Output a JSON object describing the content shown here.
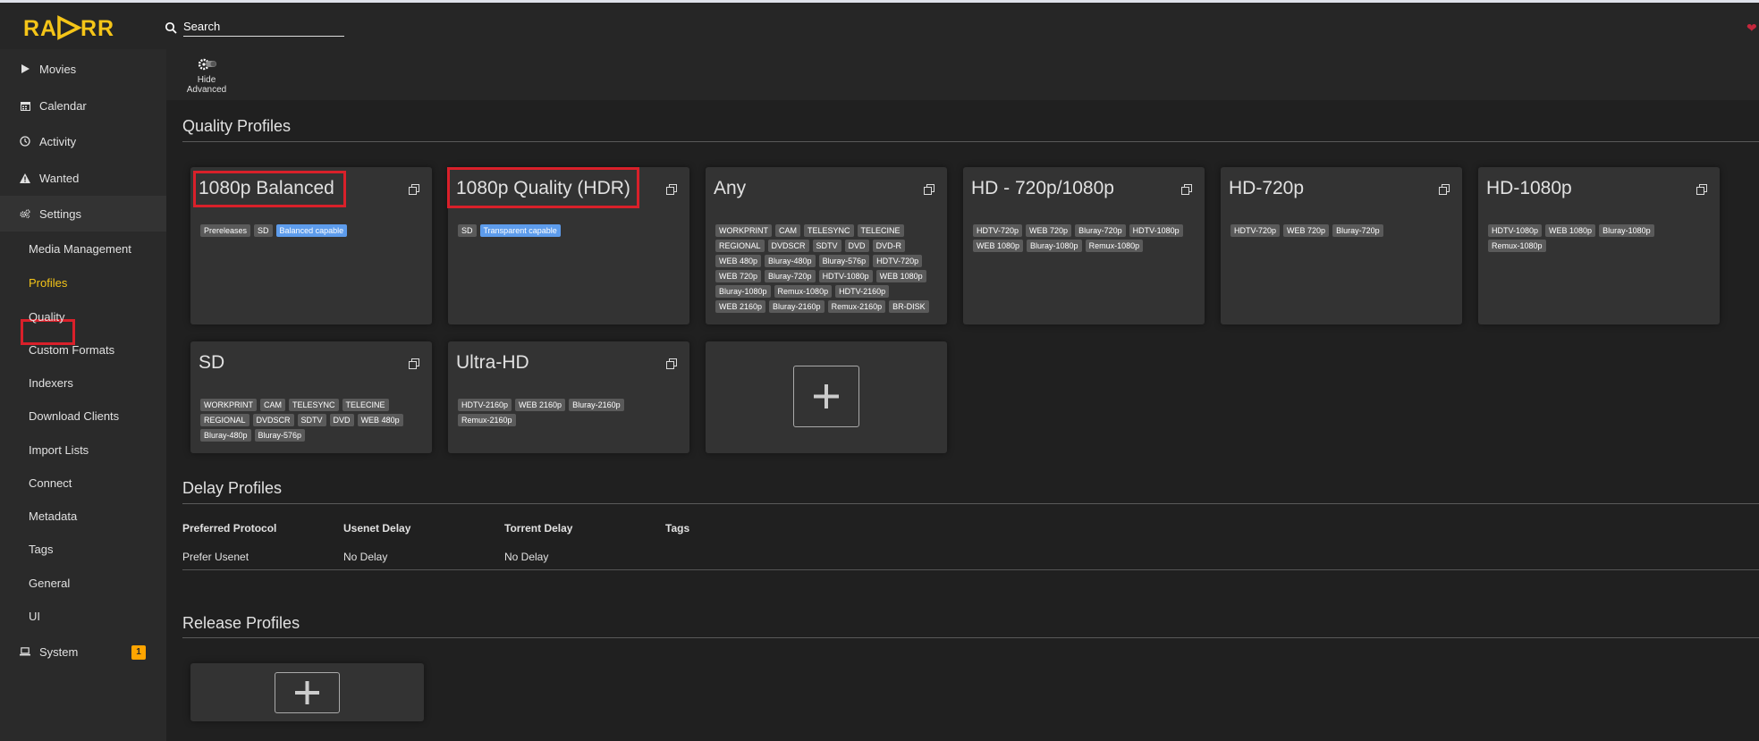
{
  "header": {
    "logo_text": "RADARR",
    "search_placeholder": "Search"
  },
  "sidebar": {
    "items": [
      {
        "label": "Movies",
        "icon": "play-icon"
      },
      {
        "label": "Calendar",
        "icon": "calendar-icon"
      },
      {
        "label": "Activity",
        "icon": "clock-icon"
      },
      {
        "label": "Wanted",
        "icon": "warning-icon"
      },
      {
        "label": "Settings",
        "icon": "gears-icon"
      },
      {
        "label": "System",
        "icon": "laptop-icon",
        "badge": "1"
      }
    ],
    "settings_children": [
      "Media Management",
      "Profiles",
      "Quality",
      "Custom Formats",
      "Indexers",
      "Download Clients",
      "Import Lists",
      "Connect",
      "Metadata",
      "Tags",
      "General",
      "UI"
    ],
    "selected_child": "Profiles"
  },
  "toolbar": {
    "advanced_label_line1": "Hide",
    "advanced_label_line2": "Advanced"
  },
  "quality_profiles": {
    "title": "Quality Profiles",
    "profiles": [
      {
        "name": "1080p Balanced",
        "tags": [
          "Prereleases",
          "SD"
        ],
        "info_tags": [
          "Balanced capable"
        ]
      },
      {
        "name": "1080p Quality (HDR)",
        "tags": [
          "SD"
        ],
        "info_tags": [
          "Transparent capable"
        ]
      },
      {
        "name": "Any",
        "tags": [
          "WORKPRINT",
          "CAM",
          "TELESYNC",
          "TELECINE",
          "REGIONAL",
          "DVDSCR",
          "SDTV",
          "DVD",
          "DVD-R",
          "WEB 480p",
          "Bluray-480p",
          "Bluray-576p",
          "HDTV-720p",
          "WEB 720p",
          "Bluray-720p",
          "HDTV-1080p",
          "WEB 1080p",
          "Bluray-1080p",
          "Remux-1080p",
          "HDTV-2160p",
          "WEB 2160p",
          "Bluray-2160p",
          "Remux-2160p",
          "BR-DISK"
        ],
        "info_tags": []
      },
      {
        "name": "HD - 720p/1080p",
        "tags": [
          "HDTV-720p",
          "WEB 720p",
          "Bluray-720p",
          "HDTV-1080p",
          "WEB 1080p",
          "Bluray-1080p",
          "Remux-1080p"
        ],
        "info_tags": []
      },
      {
        "name": "HD-720p",
        "tags": [
          "HDTV-720p",
          "WEB 720p",
          "Bluray-720p"
        ],
        "info_tags": []
      },
      {
        "name": "HD-1080p",
        "tags": [
          "HDTV-1080p",
          "WEB 1080p",
          "Bluray-1080p",
          "Remux-1080p"
        ],
        "info_tags": []
      },
      {
        "name": "SD",
        "tags": [
          "WORKPRINT",
          "CAM",
          "TELESYNC",
          "TELECINE",
          "REGIONAL",
          "DVDSCR",
          "SDTV",
          "DVD",
          "WEB 480p",
          "Bluray-480p",
          "Bluray-576p"
        ],
        "info_tags": []
      },
      {
        "name": "Ultra-HD",
        "tags": [
          "HDTV-2160p",
          "WEB 2160p",
          "Bluray-2160p",
          "Remux-2160p"
        ],
        "info_tags": []
      }
    ]
  },
  "delay_profiles": {
    "title": "Delay Profiles",
    "columns": [
      "Preferred Protocol",
      "Usenet Delay",
      "Torrent Delay",
      "Tags"
    ],
    "rows": [
      [
        "Prefer Usenet",
        "No Delay",
        "No Delay",
        ""
      ]
    ]
  },
  "release_profiles": {
    "title": "Release Profiles"
  },
  "colors": {
    "accent": "#f5c518",
    "highlight": "#d9202a",
    "info_tag": "#5d9cec",
    "badge": "#ffa500"
  }
}
